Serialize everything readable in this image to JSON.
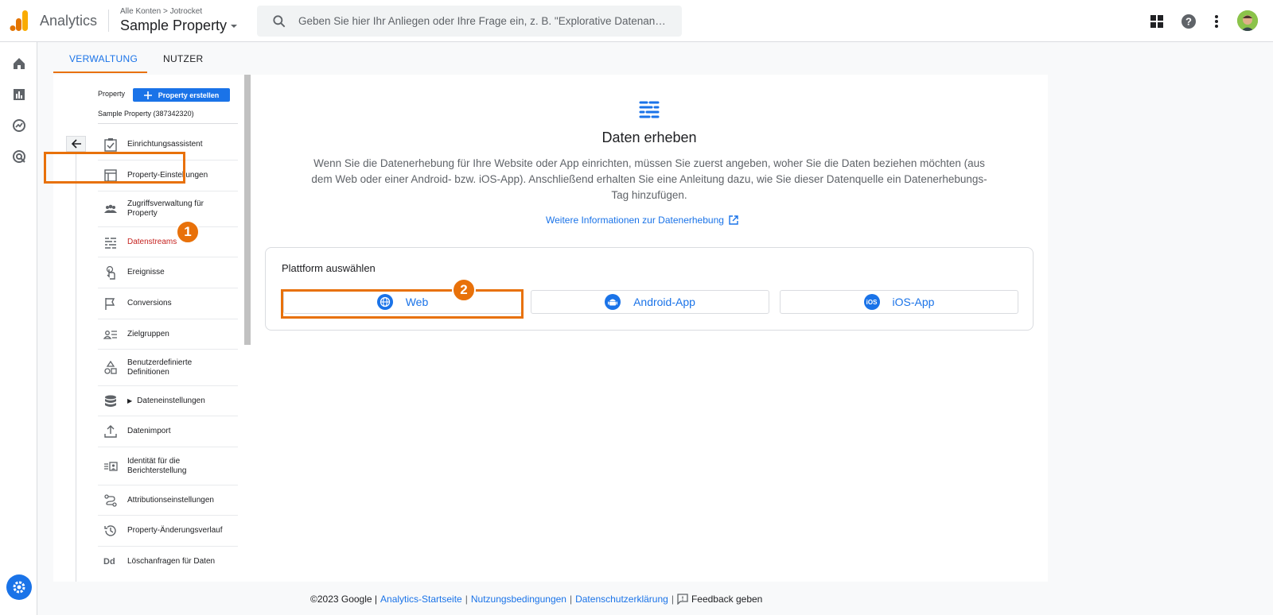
{
  "header": {
    "app_name": "Analytics",
    "breadcrumb_root": "Alle Konten",
    "breadcrumb_account": "Jotrocket",
    "property": "Sample Property",
    "search_placeholder": "Geben Sie hier Ihr Anliegen oder Ihre Frage ein, z. B. \"Explorative Datenan…"
  },
  "tabs": [
    {
      "label": "VERWALTUNG",
      "active": true
    },
    {
      "label": "NUTZER",
      "active": false
    }
  ],
  "nav": {
    "property_label": "Property",
    "create_button": "Property erstellen",
    "property_name": "Sample Property (387342320)",
    "items": [
      {
        "label": "Einrichtungsassistent",
        "icon": "checklist-icon"
      },
      {
        "label": "Property-Einstellungen",
        "icon": "window-icon"
      },
      {
        "label": "Zugriffsverwaltung für Property",
        "icon": "people-icon"
      },
      {
        "label": "Datenstreams",
        "icon": "streams-icon",
        "active": true
      },
      {
        "label": "Ereignisse",
        "icon": "touch-icon"
      },
      {
        "label": "Conversions",
        "icon": "flag-icon"
      },
      {
        "label": "Zielgruppen",
        "icon": "audience-icon"
      },
      {
        "label": "Benutzerdefinierte Definitionen",
        "icon": "shapes-icon"
      },
      {
        "label": "Dateneinstellungen",
        "icon": "database-icon"
      },
      {
        "label": "Datenimport",
        "icon": "upload-icon"
      },
      {
        "label": "Identität für die Berichterstellung",
        "icon": "identity-icon"
      },
      {
        "label": "Attributionseinstellungen",
        "icon": "attribution-icon"
      },
      {
        "label": "Property-Änderungsverlauf",
        "icon": "history-icon"
      },
      {
        "label": "Löschanfragen für Daten",
        "icon": "dd-icon"
      }
    ]
  },
  "content": {
    "title": "Daten erheben",
    "description": "Wenn Sie die Datenerhebung für Ihre Website oder App einrichten, müssen Sie zuerst angeben, woher Sie die Daten beziehen möchten (aus dem Web oder einer Android- bzw. iOS-App). Anschließend erhalten Sie eine Anleitung dazu, wie Sie dieser Datenquelle ein Datenerhebungs-Tag hinzufügen.",
    "more_link": "Weitere Informationen zur Datenerhebung",
    "platform_label": "Plattform auswählen",
    "platforms": [
      "Web",
      "Android-App",
      "iOS-App"
    ]
  },
  "annotations": {
    "badge1": "1",
    "badge2": "2"
  },
  "footer": {
    "copyright": "©2023 Google |",
    "link1": "Analytics-Startseite",
    "link2": "Nutzungsbedingungen",
    "link3": "Datenschutzerklärung",
    "feedback": "Feedback geben"
  },
  "colors": {
    "accent": "#1a73e8",
    "highlight": "#e8710a",
    "active_nav": "#c5221f"
  }
}
